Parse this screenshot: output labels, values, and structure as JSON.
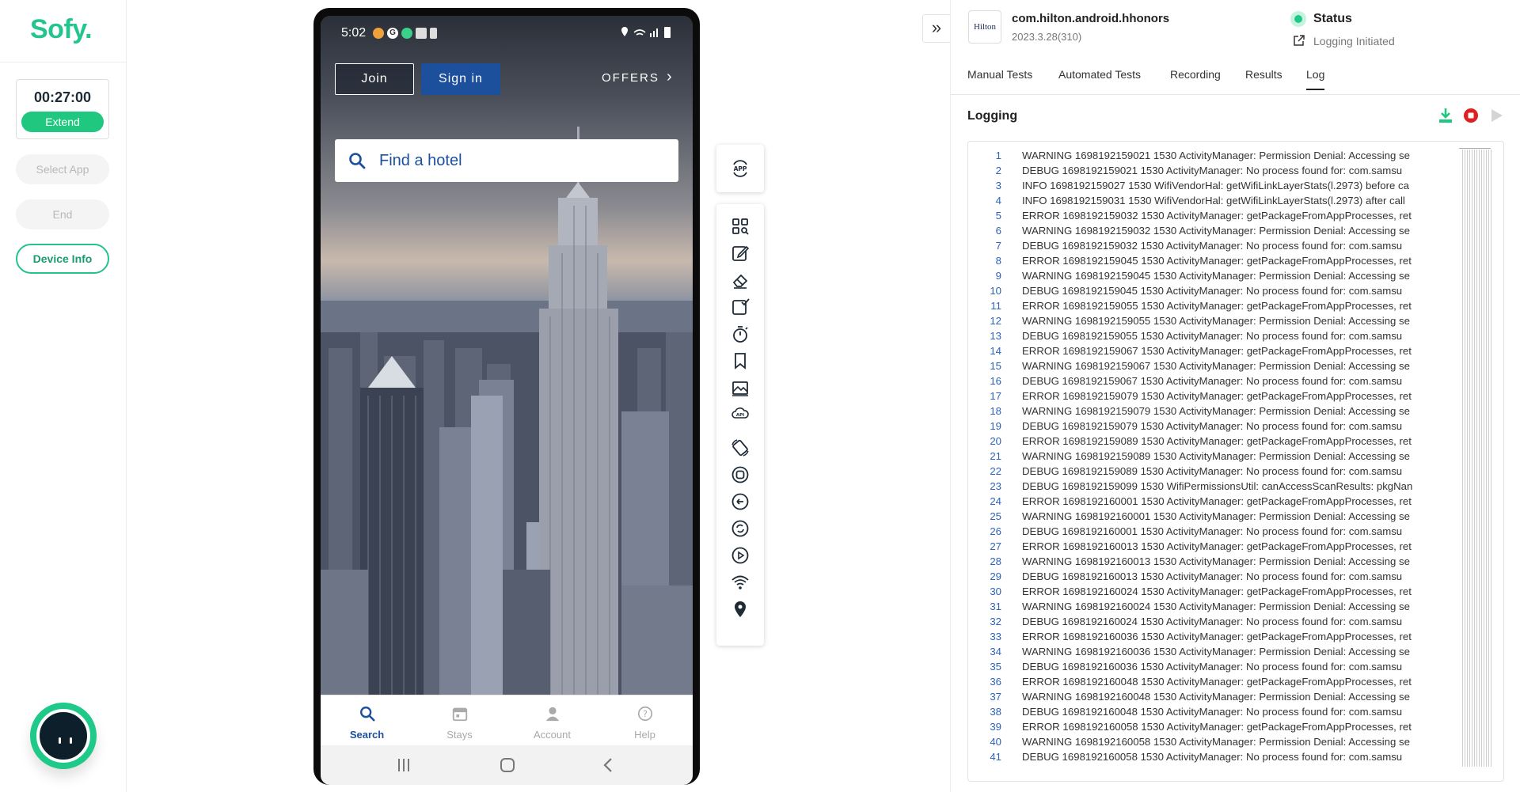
{
  "sidebar": {
    "logo": "Sofy.",
    "timer": "00:27:00",
    "extend_label": "Extend",
    "select_app_label": "Select App",
    "end_label": "End",
    "device_info_label": "Device Info"
  },
  "phone": {
    "status_time": "5:02",
    "join_label": "Join",
    "signin_label": "Sign in",
    "offers_label": "OFFERS",
    "search_placeholder": "Find a hotel",
    "nav": [
      {
        "label": "Search",
        "icon": "search-icon",
        "active": true
      },
      {
        "label": "Stays",
        "icon": "calendar-icon",
        "active": false
      },
      {
        "label": "Account",
        "icon": "person-icon",
        "active": false
      },
      {
        "label": "Help",
        "icon": "help-icon",
        "active": false
      }
    ]
  },
  "tools": {
    "app_icon_label": "APP",
    "api_icon_label": "API",
    "icons": [
      "apps-search-icon",
      "edit-icon",
      "eraser-icon",
      "checkbox-icon",
      "stopwatch-icon",
      "bookmark-icon",
      "image-icon",
      "api-cloud-icon",
      "rotate-icon",
      "home-circle-icon",
      "back-circle-icon",
      "refresh-circle-icon",
      "play-circle-icon",
      "wifi-icon",
      "location-icon"
    ]
  },
  "panel": {
    "app_logo_text": "Hilton",
    "package_name": "com.hilton.android.hhonors",
    "version": "2023.3.28(310)",
    "status_title": "Status",
    "status_text": "Logging Initiated",
    "tabs": [
      "Manual Tests",
      "Automated Tests",
      "Recording",
      "Results",
      "Log"
    ],
    "active_tab": "Log",
    "logging_title": "Logging",
    "colors": {
      "accent": "#20c77f",
      "stop": "#e02020",
      "link": "#2e63b8"
    }
  },
  "log_lines": [
    {
      "num": "1",
      "text": "WARNING 1698192159021 1530  ActivityManager: Permission Denial: Accessing se"
    },
    {
      "num": "2",
      "text": "DEBUG 1698192159021 1530  ActivityManager: No process found for: com.samsu"
    },
    {
      "num": "3",
      "text": "INFO 1698192159027 1530  WifiVendorHal: getWifiLinkLayerStats(l.2973) before ca"
    },
    {
      "num": "4",
      "text": "INFO 1698192159031 1530  WifiVendorHal: getWifiLinkLayerStats(l.2973) after call"
    },
    {
      "num": "5",
      "text": "ERROR 1698192159032 1530  ActivityManager: getPackageFromAppProcesses, ret"
    },
    {
      "num": "6",
      "text": "WARNING 1698192159032 1530  ActivityManager: Permission Denial: Accessing se"
    },
    {
      "num": "7",
      "text": "DEBUG 1698192159032 1530  ActivityManager: No process found for: com.samsu"
    },
    {
      "num": "8",
      "text": "ERROR 1698192159045 1530  ActivityManager: getPackageFromAppProcesses, ret"
    },
    {
      "num": "9",
      "text": "WARNING 1698192159045 1530  ActivityManager: Permission Denial: Accessing se"
    },
    {
      "num": "10",
      "text": "DEBUG 1698192159045 1530  ActivityManager: No process found for: com.samsu"
    },
    {
      "num": "11",
      "text": "ERROR 1698192159055 1530  ActivityManager: getPackageFromAppProcesses, ret"
    },
    {
      "num": "12",
      "text": "WARNING 1698192159055 1530  ActivityManager: Permission Denial: Accessing se"
    },
    {
      "num": "13",
      "text": "DEBUG 1698192159055 1530  ActivityManager: No process found for: com.samsu"
    },
    {
      "num": "14",
      "text": "ERROR 1698192159067 1530  ActivityManager: getPackageFromAppProcesses, ret"
    },
    {
      "num": "15",
      "text": "WARNING 1698192159067 1530  ActivityManager: Permission Denial: Accessing se"
    },
    {
      "num": "16",
      "text": "DEBUG 1698192159067 1530  ActivityManager: No process found for: com.samsu"
    },
    {
      "num": "17",
      "text": "ERROR 1698192159079 1530  ActivityManager: getPackageFromAppProcesses, ret"
    },
    {
      "num": "18",
      "text": "WARNING 1698192159079 1530  ActivityManager: Permission Denial: Accessing se"
    },
    {
      "num": "19",
      "text": "DEBUG 1698192159079 1530  ActivityManager: No process found for: com.samsu"
    },
    {
      "num": "20",
      "text": "ERROR 1698192159089 1530  ActivityManager: getPackageFromAppProcesses, ret"
    },
    {
      "num": "21",
      "text": "WARNING 1698192159089 1530  ActivityManager: Permission Denial: Accessing se"
    },
    {
      "num": "22",
      "text": "DEBUG 1698192159089 1530  ActivityManager: No process found for: com.samsu"
    },
    {
      "num": "23",
      "text": "DEBUG 1698192159099 1530  WifiPermissionsUtil: canAccessScanResults: pkgNan"
    },
    {
      "num": "24",
      "text": "ERROR 1698192160001 1530  ActivityManager: getPackageFromAppProcesses, ret"
    },
    {
      "num": "25",
      "text": "WARNING 1698192160001 1530  ActivityManager: Permission Denial: Accessing se"
    },
    {
      "num": "26",
      "text": "DEBUG 1698192160001 1530  ActivityManager: No process found for: com.samsu"
    },
    {
      "num": "27",
      "text": "ERROR 1698192160013 1530  ActivityManager: getPackageFromAppProcesses, ret"
    },
    {
      "num": "28",
      "text": "WARNING 1698192160013 1530  ActivityManager: Permission Denial: Accessing se"
    },
    {
      "num": "29",
      "text": "DEBUG 1698192160013 1530  ActivityManager: No process found for: com.samsu"
    },
    {
      "num": "30",
      "text": "ERROR 1698192160024 1530  ActivityManager: getPackageFromAppProcesses, ret"
    },
    {
      "num": "31",
      "text": "WARNING 1698192160024 1530  ActivityManager: Permission Denial: Accessing se"
    },
    {
      "num": "32",
      "text": "DEBUG 1698192160024 1530  ActivityManager: No process found for: com.samsu"
    },
    {
      "num": "33",
      "text": "ERROR 1698192160036 1530  ActivityManager: getPackageFromAppProcesses, ret"
    },
    {
      "num": "34",
      "text": "WARNING 1698192160036 1530  ActivityManager: Permission Denial: Accessing se"
    },
    {
      "num": "35",
      "text": "DEBUG 1698192160036 1530  ActivityManager: No process found for: com.samsu"
    },
    {
      "num": "36",
      "text": "ERROR 1698192160048 1530  ActivityManager: getPackageFromAppProcesses, ret"
    },
    {
      "num": "37",
      "text": "WARNING 1698192160048 1530  ActivityManager: Permission Denial: Accessing se"
    },
    {
      "num": "38",
      "text": "DEBUG 1698192160048 1530  ActivityManager: No process found for: com.samsu"
    },
    {
      "num": "39",
      "text": "ERROR 1698192160058 1530  ActivityManager: getPackageFromAppProcesses, ret"
    },
    {
      "num": "40",
      "text": "WARNING 1698192160058 1530  ActivityManager: Permission Denial: Accessing se"
    },
    {
      "num": "41",
      "text": "DEBUG 1698192160058 1530  ActivityManager: No process found for: com.samsu"
    }
  ]
}
